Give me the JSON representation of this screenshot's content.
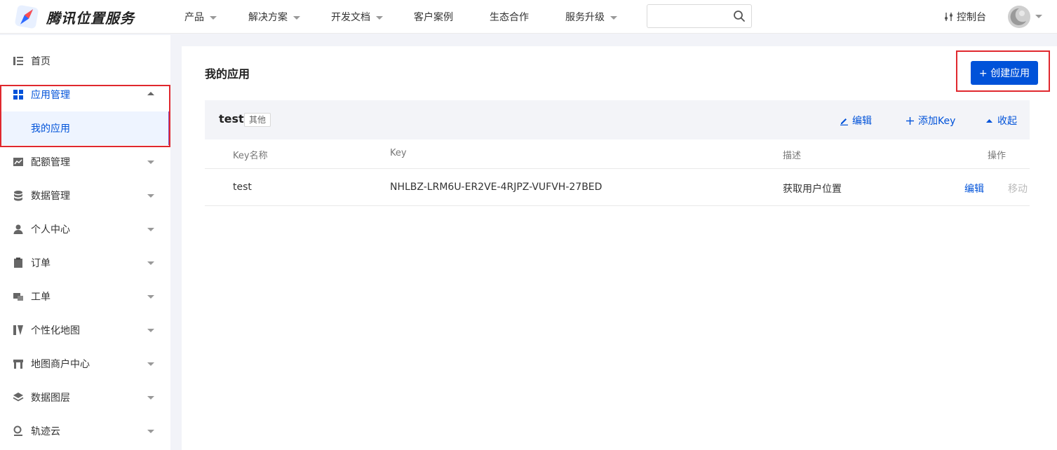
{
  "header": {
    "brand": "腾讯位置服务",
    "nav": [
      {
        "label": "产品",
        "caret": true
      },
      {
        "label": "解决方案",
        "caret": true
      },
      {
        "label": "开发文档",
        "caret": true
      },
      {
        "label": "客户案例",
        "caret": false
      },
      {
        "label": "生态合作",
        "caret": false
      },
      {
        "label": "服务升级",
        "caret": true
      }
    ],
    "search_value": "",
    "console_label": "控制台"
  },
  "sidebar": {
    "items": [
      {
        "label": "首页",
        "icon": "list-icon"
      },
      {
        "label": "应用管理",
        "icon": "grid-icon",
        "expanded": true
      },
      {
        "label": "配额管理",
        "icon": "chart-icon"
      },
      {
        "label": "数据管理",
        "icon": "database-icon"
      },
      {
        "label": "个人中心",
        "icon": "user-icon"
      },
      {
        "label": "订单",
        "icon": "clipboard-icon"
      },
      {
        "label": "工单",
        "icon": "ticket-icon"
      },
      {
        "label": "个性化地图",
        "icon": "map-style-icon"
      },
      {
        "label": "地图商户中心",
        "icon": "store-icon"
      },
      {
        "label": "数据图层",
        "icon": "layers-icon"
      },
      {
        "label": "轨迹云",
        "icon": "track-icon"
      }
    ],
    "sub_item": "我的应用"
  },
  "main": {
    "title": "我的应用",
    "create_label": "+ 创建应用",
    "app": {
      "name": "test",
      "tag": "其他",
      "edit_label": "编辑",
      "add_key_label": "添加Key",
      "collapse_label": "收起"
    },
    "table": {
      "headers": [
        "Key名称",
        "Key",
        "描述",
        "操作"
      ],
      "rows": [
        {
          "name": "test",
          "key": "NHLBZ-LRM6U-ER2VE-4RJPZ-VUFVH-27BED",
          "desc": "获取用户位置",
          "edit": "编辑",
          "move": "移动"
        }
      ]
    }
  },
  "colors": {
    "primary": "#0052d9",
    "highlight": "#e0282e"
  }
}
